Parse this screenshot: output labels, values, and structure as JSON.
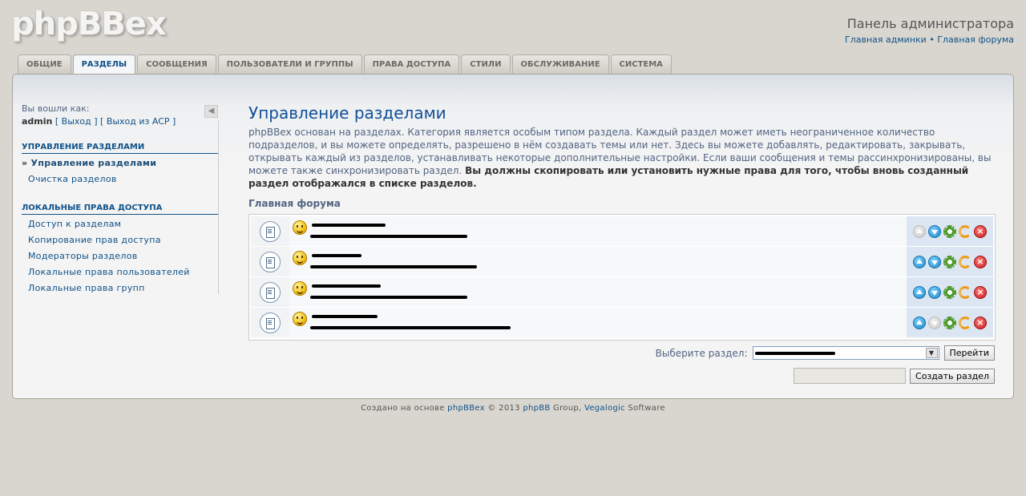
{
  "logo": "phpBBex",
  "header": {
    "title": "Панель администратора",
    "link_admin": "Главная админки",
    "separator": " • ",
    "link_forum": "Главная форума"
  },
  "tabs": [
    "Общие",
    "Разделы",
    "Сообщения",
    "Пользователи и группы",
    "Права доступа",
    "Стили",
    "Обслуживание",
    "Система"
  ],
  "sidebar": {
    "login_label": "Вы вошли как:",
    "username": "admin",
    "logout": "[ Выход ]",
    "exit_acp": "[ Выход из ACP ]",
    "section1_title": "Управление разделами",
    "section1_items": [
      "Управление разделами",
      "Очистка разделов"
    ],
    "section2_title": "Локальные права доступа",
    "section2_items": [
      "Доступ к разделам",
      "Копирование прав доступа",
      "Модераторы разделов",
      "Локальные права пользователей",
      "Локальные права групп"
    ]
  },
  "main": {
    "title": "Управление разделами",
    "intro_text": "phpBBex основан на разделах. Категория является особым типом раздела. Каждый раздел может иметь неограниченное количество подразделов, и вы можете определять, разрешено в нём создавать темы или нет. Здесь вы можете добавлять, редактировать, закрывать, открывать каждый из разделов, устанавливать некоторые дополнительные настройки. Если ваши сообщения и темы рассинхронизированы, вы можете также синхронизировать раздел. ",
    "intro_bold": "Вы должны скопировать или установить нужные права для того, чтобы вновь созданный раздел отображался в списке разделов.",
    "group_title": "Главная форума",
    "rows": [
      {
        "up_disabled": true,
        "down_disabled": false
      },
      {
        "up_disabled": false,
        "down_disabled": false
      },
      {
        "up_disabled": false,
        "down_disabled": false
      },
      {
        "up_disabled": false,
        "down_disabled": true
      }
    ],
    "select_label": "Выберите раздел:",
    "go_button": "Перейти",
    "create_button": "Создать раздел"
  },
  "footer": {
    "prefix": "Создано на основе ",
    "phpbbex": "phpBBex",
    "copy": " © 2013 ",
    "phpbb": "phpBB",
    "group": " Group, ",
    "vegalogic": "Vegalogic",
    "software": " Software"
  }
}
